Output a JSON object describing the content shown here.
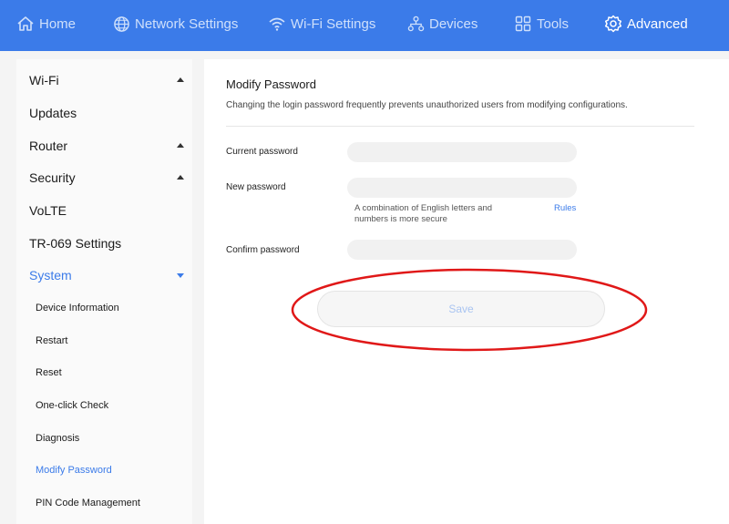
{
  "nav": {
    "items": [
      {
        "label": "Home",
        "icon": "home-icon"
      },
      {
        "label": "Network Settings",
        "icon": "globe-icon"
      },
      {
        "label": "Wi-Fi Settings",
        "icon": "wifi-icon"
      },
      {
        "label": "Devices",
        "icon": "devices-icon"
      },
      {
        "label": "Tools",
        "icon": "tools-icon"
      },
      {
        "label": "Advanced",
        "icon": "gear-icon"
      }
    ],
    "active": "Advanced"
  },
  "sidebar": {
    "items": [
      {
        "label": "Wi-Fi",
        "expandable": true,
        "state": "collapsed"
      },
      {
        "label": "Updates"
      },
      {
        "label": "Router",
        "expandable": true,
        "state": "collapsed"
      },
      {
        "label": "Security",
        "expandable": true,
        "state": "collapsed"
      },
      {
        "label": "VoLTE"
      },
      {
        "label": "TR-069 Settings"
      },
      {
        "label": "System",
        "expandable": true,
        "state": "expanded"
      }
    ],
    "subitems": [
      {
        "label": "Device Information"
      },
      {
        "label": "Restart"
      },
      {
        "label": "Reset"
      },
      {
        "label": "One-click Check"
      },
      {
        "label": "Diagnosis"
      },
      {
        "label": "Modify Password"
      },
      {
        "label": "PIN Code Management"
      }
    ],
    "active_item": "System",
    "active_subitem": "Modify Password"
  },
  "main": {
    "title": "Modify Password",
    "description": "Changing the login password frequently prevents unauthorized users from modifying configurations.",
    "fields": {
      "current_label": "Current password",
      "current_value": "",
      "new_label": "New password",
      "new_value": "",
      "hint": "A combination of English letters and numbers is more secure",
      "rules_link": "Rules",
      "confirm_label": "Confirm password",
      "confirm_value": ""
    },
    "save_label": "Save"
  },
  "colors": {
    "accent": "#3b7be9",
    "annotation": "#e01818"
  }
}
